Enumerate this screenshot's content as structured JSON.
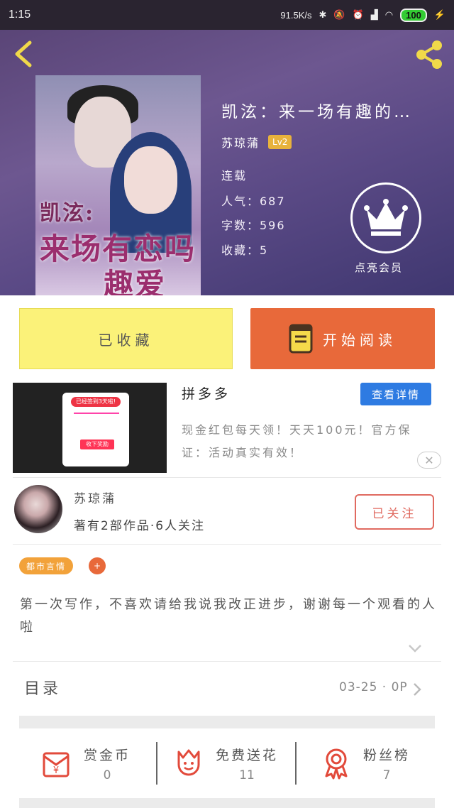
{
  "status_bar": {
    "time": "1:15",
    "net_speed": "91.5K/s",
    "battery": "100"
  },
  "book": {
    "title": "凯泫：来一场有趣的…",
    "author": "苏琼蒲",
    "level": "Lv2",
    "status": "连载",
    "popularity": "人气：687",
    "word_count": "字数：596",
    "favorites": "收藏：5",
    "cover_title_line1": "凯泫:",
    "cover_title_line2": "来场有恋吗",
    "cover_title_line3": "趣爱"
  },
  "vip": {
    "label": "点亮会员"
  },
  "actions": {
    "collected_label": "已收藏",
    "read_label": "开始阅读"
  },
  "ad": {
    "name": "拼多多",
    "detail_label": "查看详情",
    "description": "现金红包每天领！天天100元！官方保证：活动真实有效！",
    "close_label": "✕",
    "thumb_badge": "已经签到3天啦!",
    "thumb_button": "收下奖励"
  },
  "author_card": {
    "name": "苏琼蒲",
    "works": "著有2部作品·6人关注",
    "follow_label": "已关注"
  },
  "tags": {
    "category": "都市言情",
    "add": "+"
  },
  "intro": "第一次写作，不喜欢请给我说我改正进步，谢谢每一个观看的人啦",
  "toc": {
    "label": "目录",
    "date": "03-25 · 0P"
  },
  "stats": {
    "reward": {
      "label": "赏金币",
      "value": "0"
    },
    "flowers": {
      "label": "免费送花",
      "value": "11"
    },
    "fans": {
      "label": "粉丝榜",
      "value": "7"
    }
  },
  "colors": {
    "accent_orange": "#e8693a",
    "collected_yellow": "#fbf279",
    "detail_blue": "#2e7be2",
    "tag_orange": "#f2a23a",
    "icon_red": "#e24a3b"
  }
}
